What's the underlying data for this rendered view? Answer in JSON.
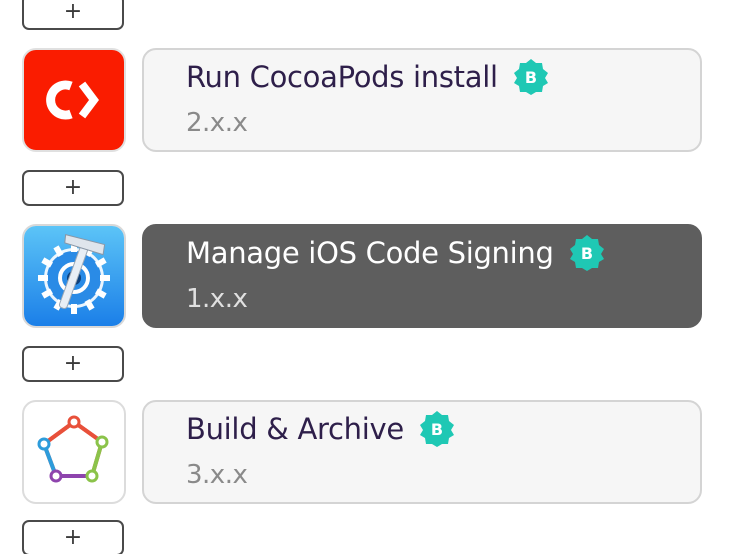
{
  "workflow": {
    "add_label": "+",
    "steps": [
      {
        "title": "Run CocoaPods install",
        "version": "2.x.x",
        "badge": "B",
        "icon": "cocoapods-icon",
        "selected": false
      },
      {
        "title": "Manage iOS Code Signing",
        "version": "1.x.x",
        "badge": "B",
        "icon": "code-signing-gear-icon",
        "selected": true
      },
      {
        "title": "Build & Archive",
        "version": "3.x.x",
        "badge": "B",
        "icon": "build-archive-icon",
        "selected": false
      }
    ]
  },
  "colors": {
    "badge": "#1fc8b4",
    "cocoapods_red": "#fa1c00",
    "selected_card": "#5e5e5e",
    "title_text": "#2e1f4a",
    "version_text": "#8a8a8a"
  }
}
